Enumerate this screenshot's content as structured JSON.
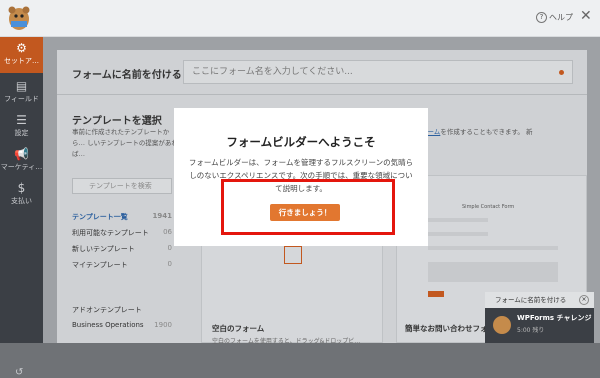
{
  "header": {
    "help_label": "ヘルプ",
    "help_icon": "question-circle-icon",
    "close_icon": "close-icon"
  },
  "sidebar": {
    "items": [
      {
        "label": "セットア…",
        "icon": "gear-icon"
      },
      {
        "label": "フィールド",
        "icon": "fields-icon"
      },
      {
        "label": "設定",
        "icon": "sliders-icon"
      },
      {
        "label": "マーケティ…",
        "icon": "megaphone-icon"
      },
      {
        "label": "支払い",
        "icon": "dollar-icon"
      }
    ]
  },
  "form_name": {
    "label": "フォームに名前を付ける",
    "placeholder": "ここにフォーム名を入力してください..."
  },
  "templates": {
    "title": "テンプレートを選択",
    "desc": "事前に作成されたテンプレートから… しいテンプレートの提案があれば…",
    "right_text_prefix": "",
    "right_link": "独自のフォーム",
    "right_text_suffix": "を作成することもできます。 新",
    "search_placeholder": "テンプレートを検索",
    "categories": [
      {
        "label": "テンプレート一覧",
        "count": "1941"
      },
      {
        "label": "利用可能なテンプレート",
        "count": "06"
      },
      {
        "label": "新しいテンプレート",
        "count": "0"
      },
      {
        "label": "マイテンプレート",
        "count": "0"
      }
    ],
    "addons_label": "アドオンテンプレート",
    "business_label": "Business Operations",
    "business_count": "1900",
    "blank_form_title": "空白のフォーム",
    "blank_form_sub": "空白のフォームを使用すると、ドラッグ&ドロップビ…",
    "simple_contact_title": "簡単なお問い合わせフォ…",
    "simple_contact_sub": "",
    "contact_preview_title": "Simple Contact Form"
  },
  "modal": {
    "title": "フォームビルダーへようこそ",
    "body": "フォームビルダーは、フォームを管理するフルスクリーンの気晴らしのないエクスペリエンスです。次の手順では、重要な領域について説明します。",
    "button": "行きましょう！"
  },
  "toast": {
    "header": "フォームに名前を付ける",
    "name": "WPForms チャレンジ",
    "time": "5:00 残り"
  },
  "colors": {
    "accent": "#e27730",
    "highlight": "#e4160d",
    "sidebar": "#3b3f45"
  }
}
